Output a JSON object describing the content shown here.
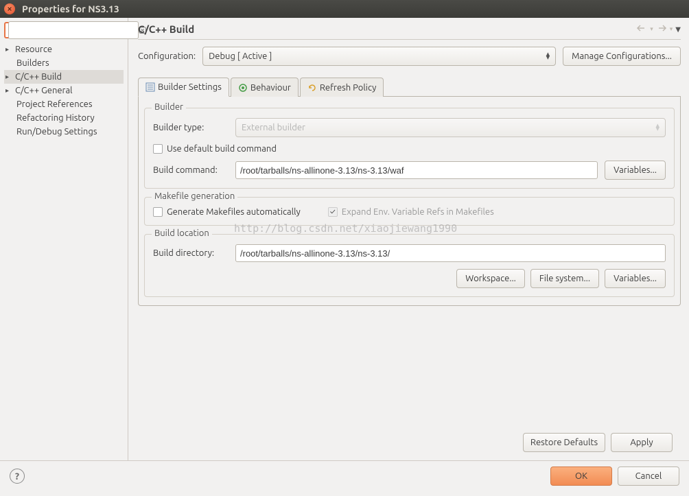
{
  "titlebar": {
    "title": "Properties for NS3.13"
  },
  "sidebar": {
    "filter_placeholder": "",
    "items": [
      {
        "label": "Resource",
        "expandable": true
      },
      {
        "label": "Builders",
        "expandable": false
      },
      {
        "label": "C/C++ Build",
        "expandable": true
      },
      {
        "label": "C/C++ General",
        "expandable": true
      },
      {
        "label": "Project References",
        "expandable": false
      },
      {
        "label": "Refactoring History",
        "expandable": false
      },
      {
        "label": "Run/Debug Settings",
        "expandable": false
      }
    ]
  },
  "main": {
    "title": "C/C++ Build",
    "config_label": "Configuration:",
    "config_value": "Debug  [ Active ]",
    "manage_btn": "Manage Configurations...",
    "tabs": {
      "builder": "Builder Settings",
      "behaviour": "Behaviour",
      "refresh": "Refresh Policy"
    },
    "builder_group": {
      "title": "Builder",
      "type_label": "Builder type:",
      "type_value": "External builder",
      "use_default_cmd": "Use default build command",
      "build_cmd_label": "Build command:",
      "build_cmd_value": "/root/tarballs/ns-allinone-3.13/ns-3.13/waf",
      "variables_btn": "Variables..."
    },
    "makefile_group": {
      "title": "Makefile generation",
      "generate_auto": "Generate Makefiles automatically",
      "expand_env": "Expand Env. Variable Refs in Makefiles"
    },
    "location_group": {
      "title": "Build location",
      "dir_label": "Build directory:",
      "dir_value": "/root/tarballs/ns-allinone-3.13/ns-3.13/",
      "workspace_btn": "Workspace...",
      "filesystem_btn": "File system...",
      "variables_btn": "Variables..."
    },
    "restore_defaults": "Restore Defaults",
    "apply": "Apply"
  },
  "footer": {
    "ok": "OK",
    "cancel": "Cancel"
  },
  "watermark": "http://blog.csdn.net/xiaojiewang1990"
}
